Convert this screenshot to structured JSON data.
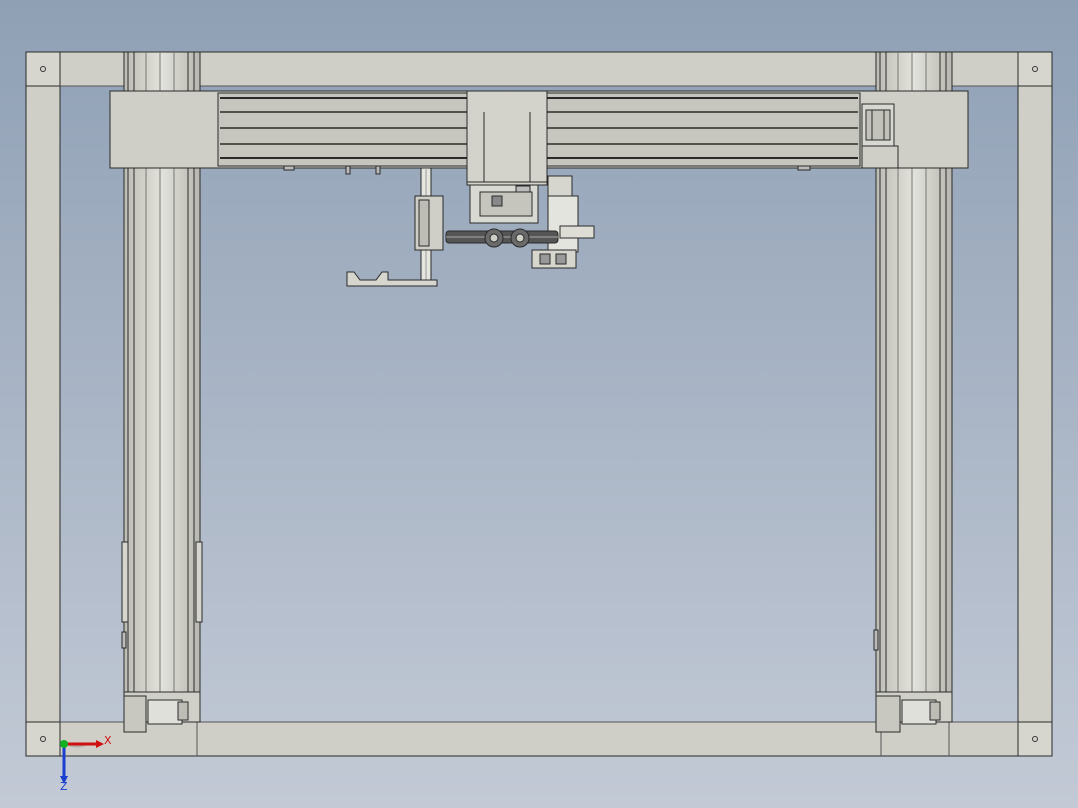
{
  "viewport": {
    "background_top": "#8fa0b5",
    "background_bottom": "#c3cad6",
    "part_fill": "#cfcfc8",
    "part_stroke": "#2a2a2a"
  },
  "triad": {
    "x_label": "X",
    "z_label": "Z",
    "x_color": "#d01010",
    "z_color": "#1a3fd0",
    "y_color": "#10b020"
  },
  "model": {
    "frame": "outer-frame",
    "columns": [
      "left-linear-module",
      "right-linear-module"
    ],
    "crossbeam": "x-axis-crossbeam",
    "carriage": "z-axis-carriage",
    "gripper": "gripper-assembly",
    "icons": [
      "corner-bolt-icon",
      "axis-triad-icon"
    ]
  }
}
